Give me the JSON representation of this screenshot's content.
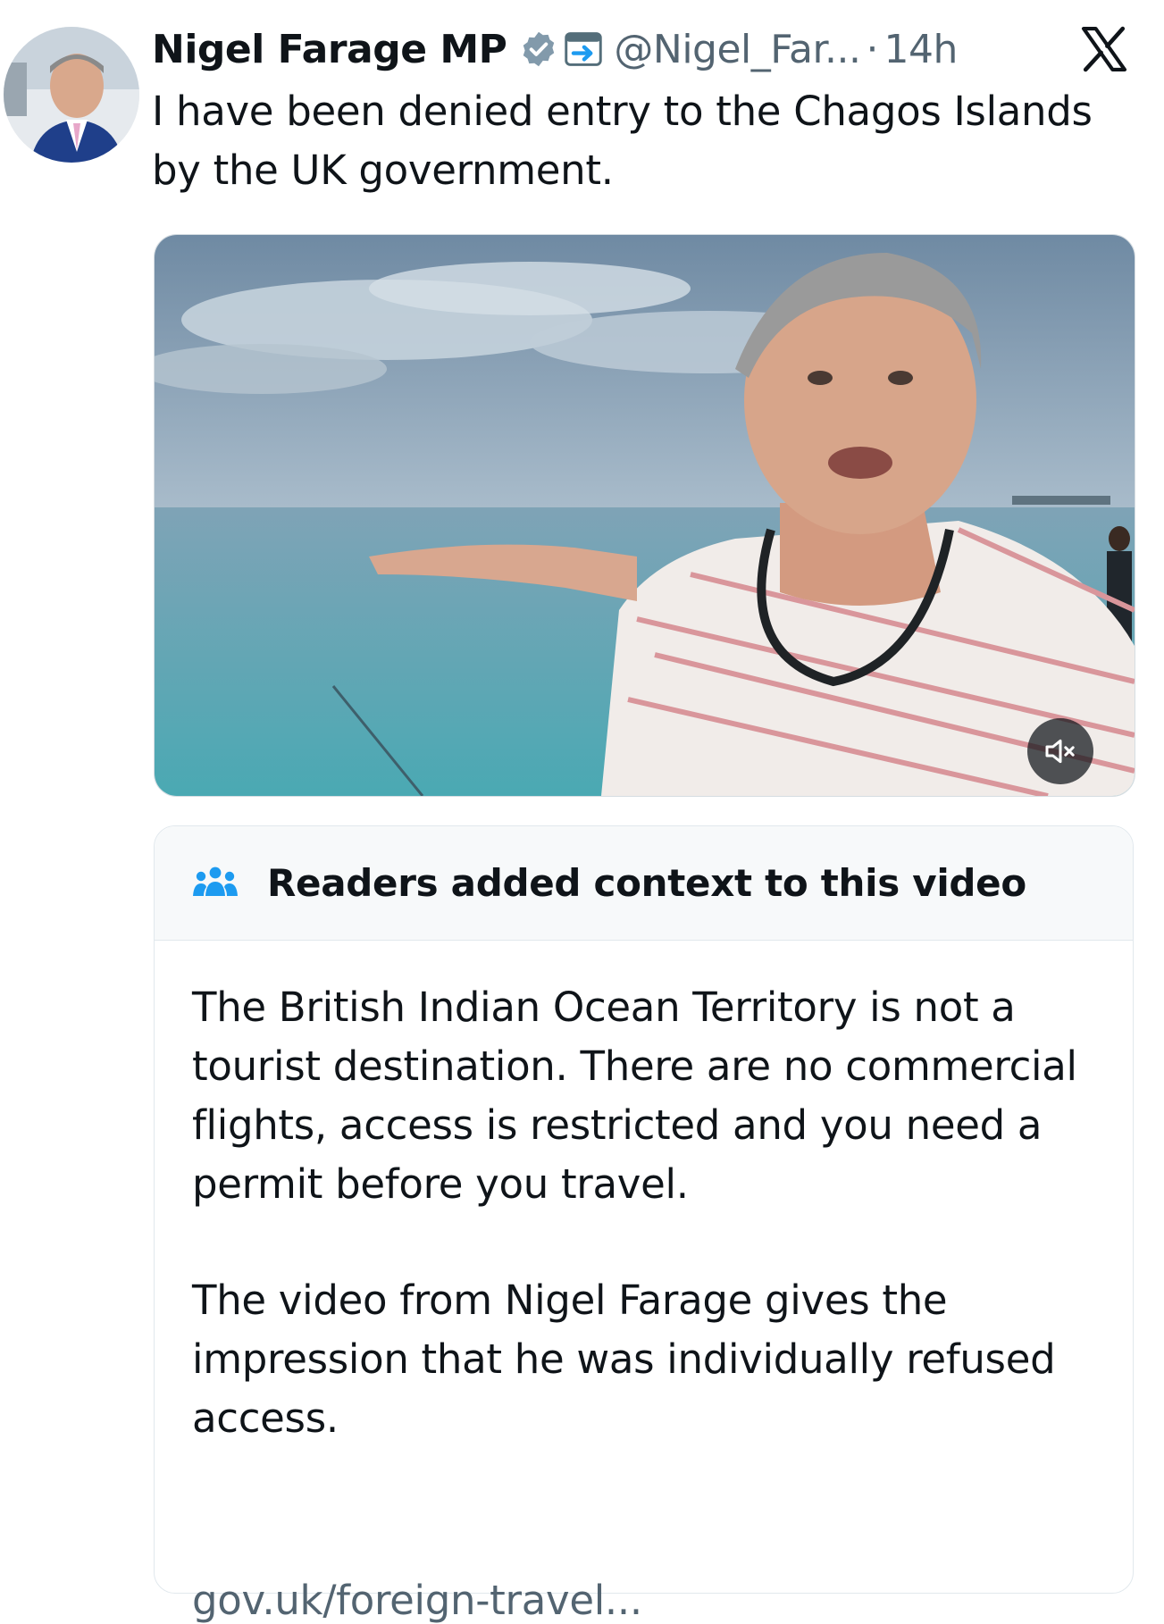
{
  "tweet": {
    "display_name": "Nigel Farage MP",
    "handle": "@Nigel_Far...",
    "separator": "·",
    "time": "14h",
    "text": "I have been denied entry to the Chagos Islands by the UK government."
  },
  "icons": {
    "verified": "verified-badge-icon",
    "affiliation": "government-affiliation-icon",
    "platform": "x-logo-icon",
    "mute": "muted-speaker-icon",
    "community": "people-icon"
  },
  "community_note": {
    "title": "Readers added context to this video",
    "paragraphs": [
      "The British Indian Ocean Territory is not a tourist destination. There are no commercial flights, access is restricted and you need a permit before you travel.",
      "The video from Nigel Farage gives the impression that he was individually refused access."
    ],
    "link": "gov.uk/foreign-travel..."
  },
  "colors": {
    "text_primary": "#0f1419",
    "text_secondary": "#536471",
    "verified_badge": "#829aab",
    "note_header_bg": "#f7f9fa",
    "community_icon": "#1d9bf0"
  }
}
